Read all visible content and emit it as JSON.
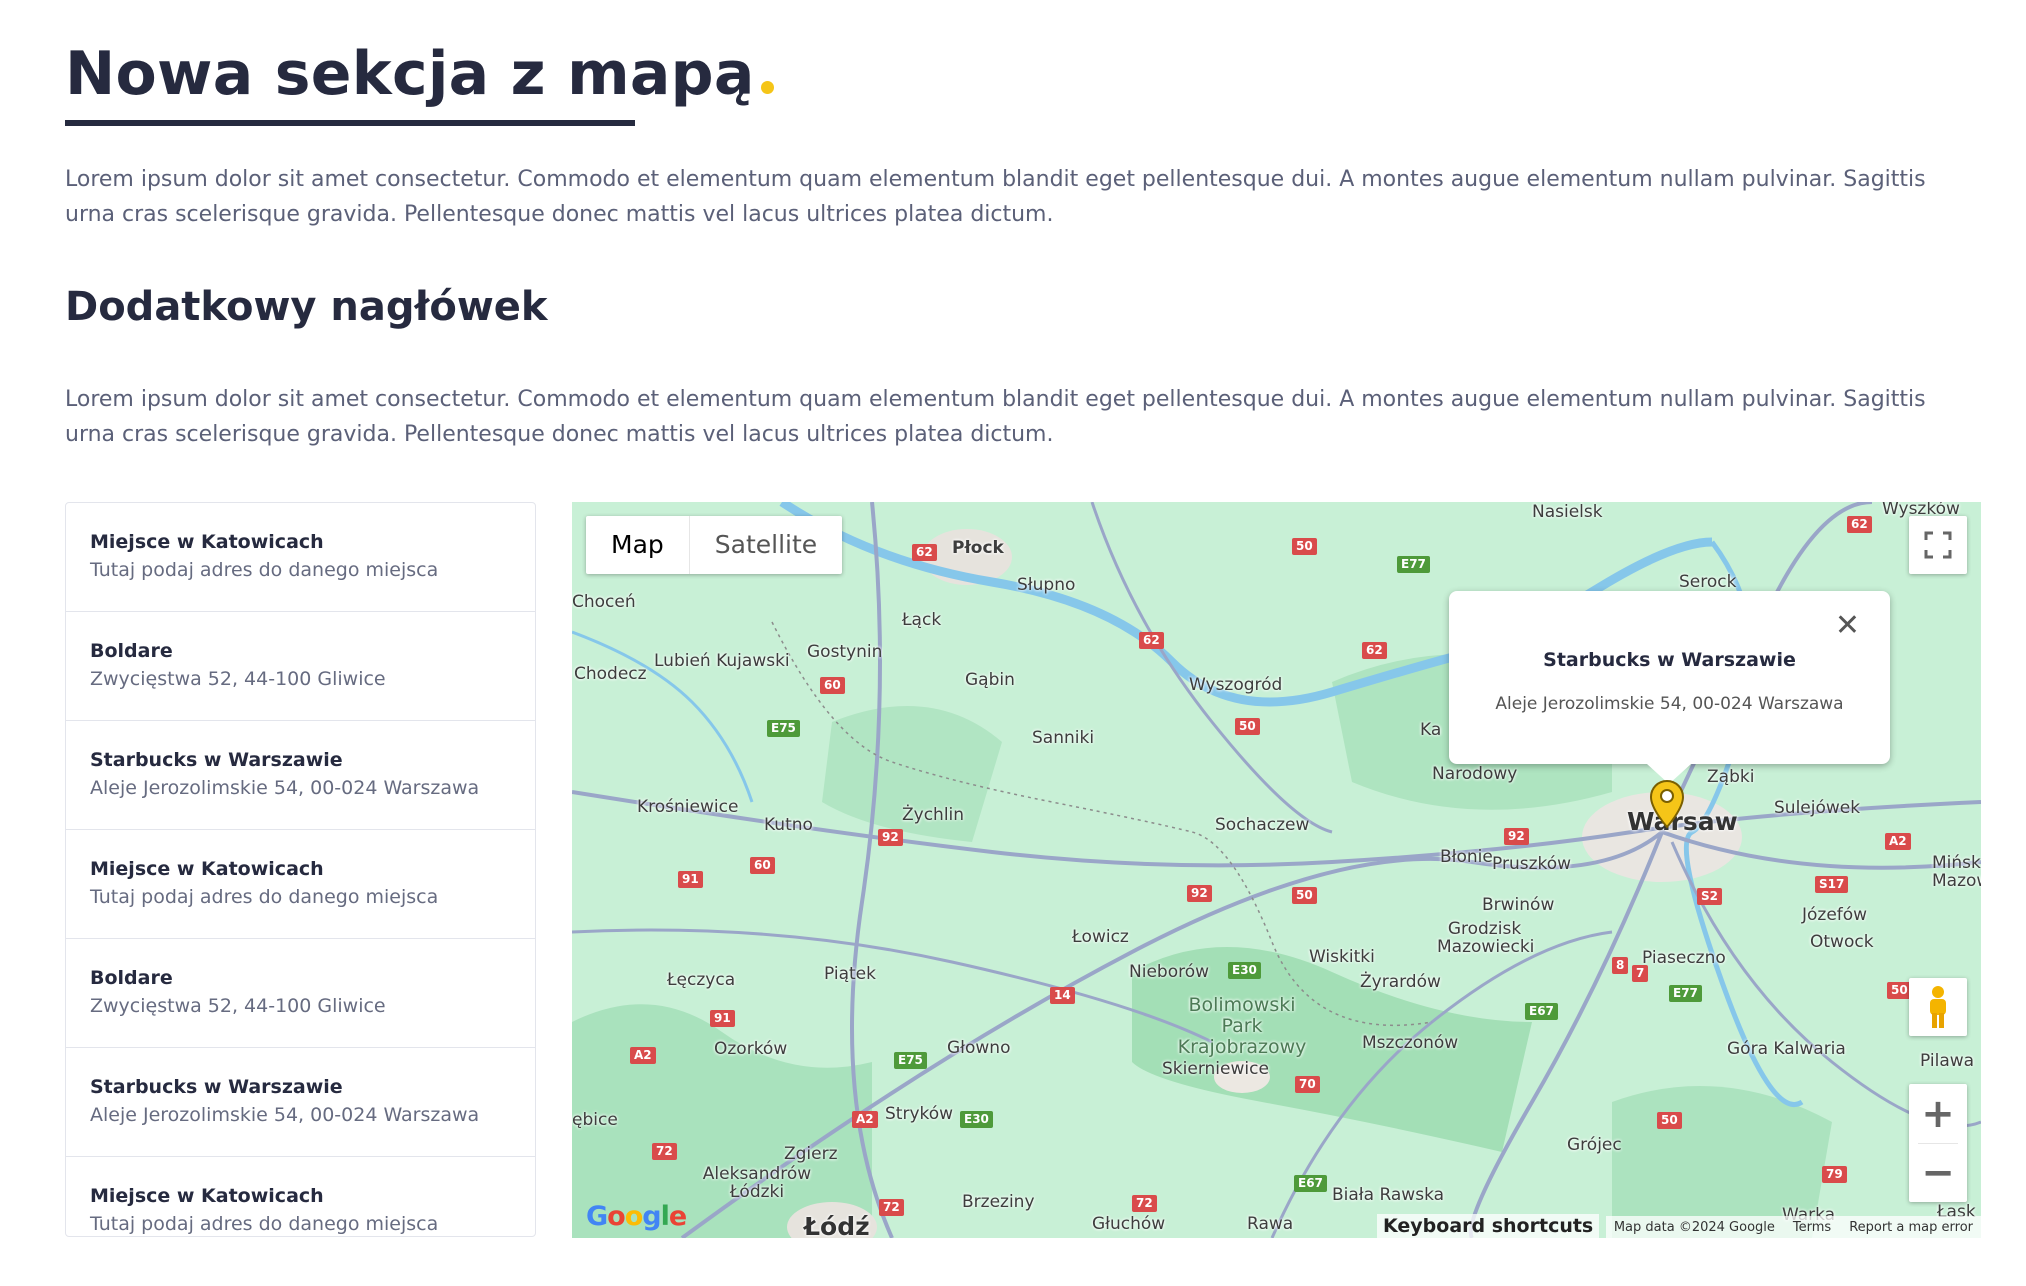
{
  "page": {
    "title": "Nowa sekcja z mapą",
    "paragraph_1": "Lorem ipsum dolor sit amet consectetur. Commodo et elementum quam elementum blandit eget pellentesque dui. A montes augue elementum nullam pulvinar. Sagittis urna cras scelerisque gravida. Pellentesque donec mattis vel lacus ultrices platea dictum.",
    "subheading": "Dodatkowy nagłówek",
    "paragraph_2": "Lorem ipsum dolor sit amet consectetur. Commodo et elementum quam elementum blandit eget pellentesque dui. A montes augue elementum nullam pulvinar. Sagittis urna cras scelerisque gravida. Pellentesque donec mattis vel lacus ultrices platea dictum.",
    "accent_color": "#f5c518"
  },
  "locations": [
    {
      "name": "Miejsce w Katowicach",
      "address": "Tutaj podaj adres do danego miejsca"
    },
    {
      "name": "Boldare",
      "address": "Zwycięstwa 52, 44-100 Gliwice"
    },
    {
      "name": "Starbucks w Warszawie",
      "address": "Aleje Jerozolimskie 54, 00-024 Warszawa"
    },
    {
      "name": "Miejsce w Katowicach",
      "address": "Tutaj podaj adres do danego miejsca"
    },
    {
      "name": "Boldare",
      "address": "Zwycięstwa 52, 44-100 Gliwice"
    },
    {
      "name": "Starbucks w Warszawie",
      "address": "Aleje Jerozolimskie 54, 00-024 Warszawa"
    },
    {
      "name": "Miejsce w Katowicach",
      "address": "Tutaj podaj adres do danego miejsca"
    }
  ],
  "map": {
    "type_buttons": {
      "map": "Map",
      "satellite": "Satellite"
    },
    "info_window": {
      "title": "Starbucks w Warszawie",
      "address": "Aleje Jerozolimskie 54, 00-024 Warszawa",
      "close": "✕"
    },
    "zoom_in": "+",
    "zoom_out": "−",
    "keyboard_shortcuts": "Keyboard shortcuts",
    "map_data": "Map data ©2024 Google",
    "terms": "Terms",
    "report": "Report a map error",
    "logo": "Google",
    "place_labels": [
      "Płock",
      "Nasielsk",
      "Wyszków",
      "Serock",
      "Słupno",
      "Łąck",
      "Gostynin",
      "Gąbin",
      "Wyszogród",
      "Lubień Kujawski",
      "Chodecz",
      "Choceń",
      "Sanniki",
      "Żychlin",
      "Kutno",
      "Krośniewice",
      "Sochaczew",
      "Błonie",
      "Pruszków",
      "Warsaw",
      "Ząbki",
      "Sulejówek",
      "Narodowy",
      "Łowicz",
      "Brwinów",
      "Grodzisk Mazowiecki",
      "Józefów",
      "Otwock",
      "Piaseczno",
      "Nieborów",
      "Wiskitki",
      "Żyrardów",
      "Bolimowski Park Krajobrazowy",
      "Skierniewice",
      "Łęczyca",
      "Piątek",
      "Ozorków",
      "Głowno",
      "Stryków",
      "Mszczonów",
      "Góra Kalwaria",
      "Grójec",
      "Zgierz",
      "Aleksandrów Łódzki",
      "Brzeziny",
      "Głuchów",
      "Rawa",
      "Biała Rawska",
      "Łódź",
      "Pilawa",
      "Warka",
      "Łask",
      "Mińsk Mazowiecki",
      "Zgierz",
      "ębice",
      "Ka"
    ],
    "road_numbers": [
      "62",
      "50",
      "E77",
      "62",
      "62",
      "60",
      "E75",
      "50",
      "92",
      "60",
      "91",
      "92",
      "50",
      "92",
      "62",
      "S2",
      "S17",
      "A2",
      "91",
      "14",
      "E30",
      "8",
      "7",
      "E77",
      "E67",
      "50",
      "A2",
      "E75",
      "70",
      "A2",
      "E30",
      "50",
      "72",
      "72",
      "72",
      "E67",
      "79",
      "A2"
    ]
  }
}
